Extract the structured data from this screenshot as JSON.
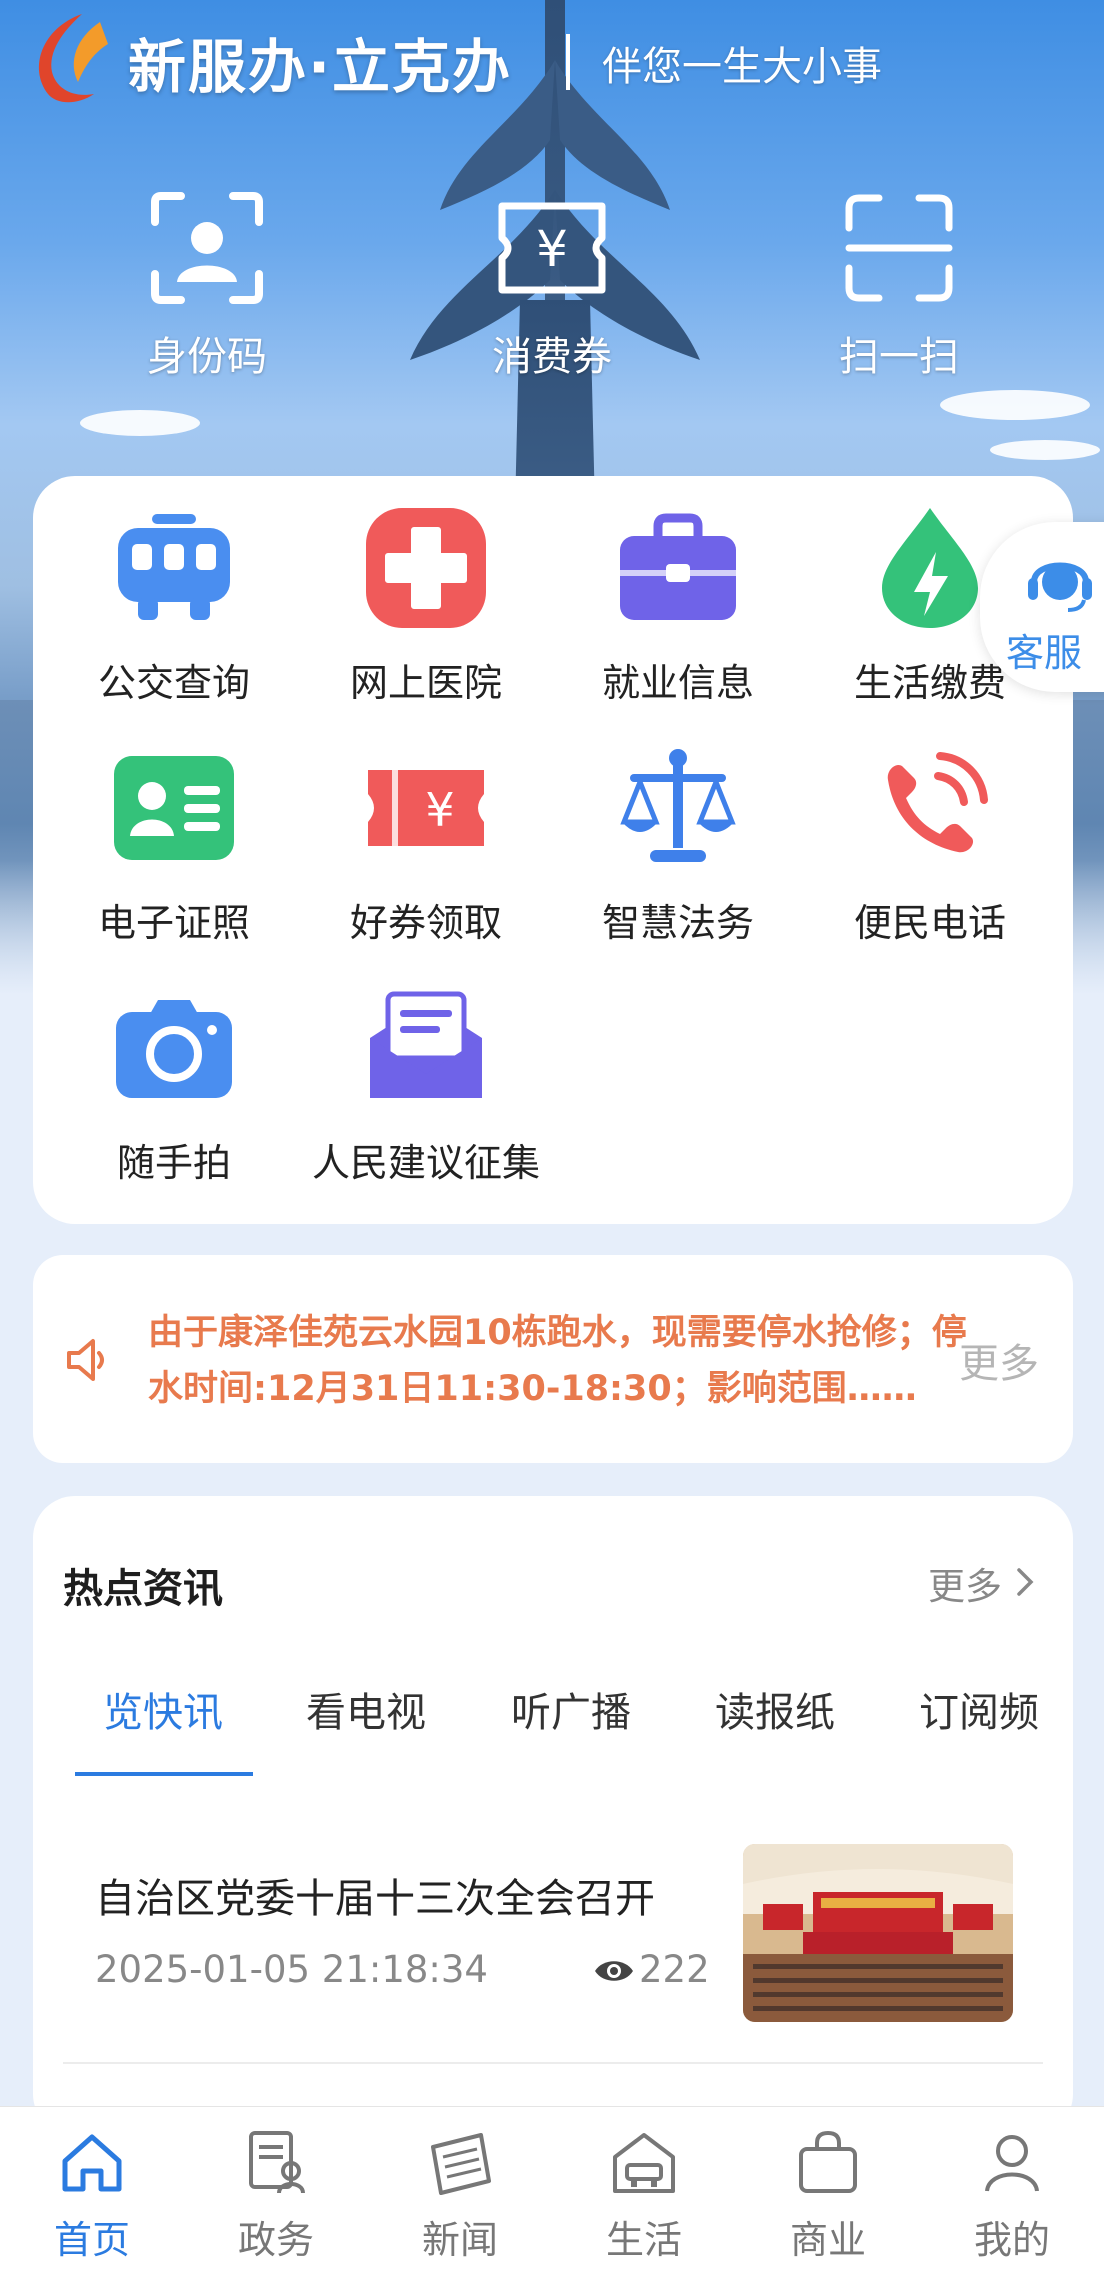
{
  "header": {
    "brand": "新服办·立克办",
    "slogan": "伴您一生大小事"
  },
  "quick_actions": [
    {
      "label": "身份码",
      "icon": "id-code-icon"
    },
    {
      "label": "消费券",
      "icon": "voucher-icon"
    },
    {
      "label": "扫一扫",
      "icon": "scan-icon"
    }
  ],
  "services": [
    {
      "label": "公交查询",
      "icon": "bus-icon",
      "color": "#4a8ef0"
    },
    {
      "label": "网上医院",
      "icon": "hospital-cross-icon",
      "color": "#f05a5a"
    },
    {
      "label": "就业信息",
      "icon": "briefcase-icon",
      "color": "#6f63e8"
    },
    {
      "label": "生活缴费",
      "icon": "energy-drop-icon",
      "color": "#34c27a"
    },
    {
      "label": "电子证照",
      "icon": "id-card-icon",
      "color": "#34c27a"
    },
    {
      "label": "好券领取",
      "icon": "coupon-icon",
      "color": "#f05a5a"
    },
    {
      "label": "智慧法务",
      "icon": "scales-icon",
      "color": "#3f80ea"
    },
    {
      "label": "便民电话",
      "icon": "phone-icon",
      "color": "#f05a5a"
    },
    {
      "label": "随手拍",
      "icon": "camera-icon",
      "color": "#4a8ef0"
    },
    {
      "label": "人民建议征集",
      "icon": "mail-icon",
      "color": "#6f63e8"
    }
  ],
  "customer_service": {
    "label": "客服",
    "icon": "headset-icon"
  },
  "notice": {
    "text": "由于康泽佳苑云水园10栋跑水，现需要停水抢修；停水时间:12月31日11:30-18:30；影响范围……",
    "more": "更多"
  },
  "news": {
    "title": "热点资讯",
    "more": "更多",
    "tabs": [
      "览快讯",
      "看电视",
      "听广播",
      "读报纸",
      "订阅频"
    ],
    "active_tab": 0,
    "article": {
      "title": "自治区党委十届十三次全会召开",
      "date": "2025-01-05 21:18:34",
      "views": "222"
    }
  },
  "tabbar": [
    {
      "label": "首页",
      "icon": "home-icon"
    },
    {
      "label": "政务",
      "icon": "government-affairs-icon"
    },
    {
      "label": "新闻",
      "icon": "newspaper-icon"
    },
    {
      "label": "生活",
      "icon": "life-icon"
    },
    {
      "label": "商业",
      "icon": "shopping-bag-icon"
    },
    {
      "label": "我的",
      "icon": "profile-icon"
    }
  ],
  "active_tab": 0,
  "colors": {
    "accent": "#2b7be0",
    "notice": "#e87a4d"
  }
}
